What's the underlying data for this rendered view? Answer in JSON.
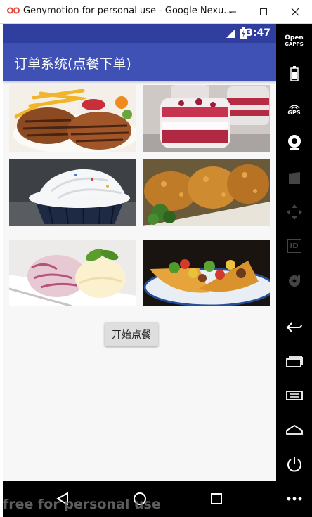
{
  "window": {
    "title": "Genymotion for personal use - Google Nexu..."
  },
  "statusbar": {
    "time": "3:47"
  },
  "app": {
    "title": "订单系统(点餐下单)"
  },
  "foods": [
    {
      "name": "steak-fries"
    },
    {
      "name": "berry-parfait"
    },
    {
      "name": "cupcake"
    },
    {
      "name": "fried-fish"
    },
    {
      "name": "ice-cream"
    },
    {
      "name": "tacos"
    }
  ],
  "order_button": {
    "label": "开始点餐"
  },
  "sidebar": {
    "open_gapps_line1": "Open",
    "open_gapps_line2": "GAPPS",
    "gps_label": "GPS",
    "id_label": "ID"
  },
  "watermark": {
    "text": "free for personal use"
  },
  "colors": {
    "statusbar": "#303f9f",
    "appbar": "#3f51b5",
    "button": "#dedede"
  }
}
